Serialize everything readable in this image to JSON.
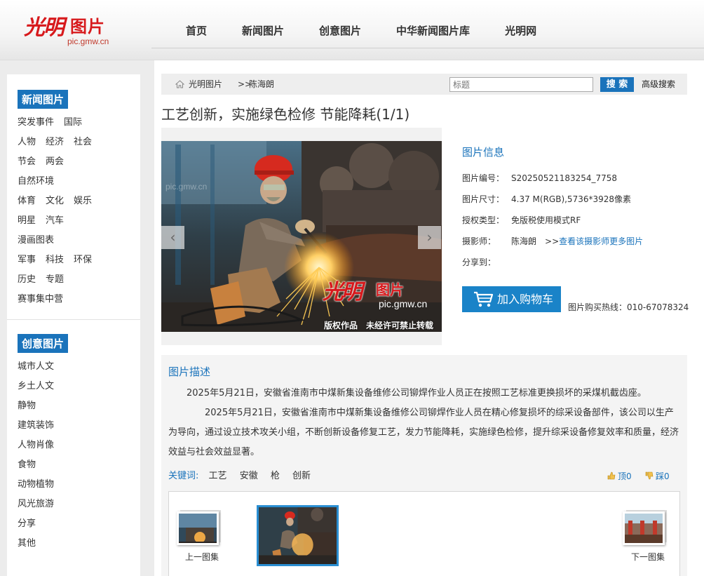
{
  "header": {
    "logo_mark": "光明",
    "logo_word": "图片",
    "logo_url": "pic.gmw.cn",
    "nav": [
      "首页",
      "新闻图片",
      "创意图片",
      "中华新闻图片库",
      "光明网"
    ]
  },
  "sidebar": {
    "news": {
      "title": "新闻图片",
      "rows": [
        [
          "突发事件",
          "国际"
        ],
        [
          "人物",
          "经济",
          "社会"
        ],
        [
          "节会",
          "两会"
        ],
        [
          "自然环境"
        ],
        [
          "体育",
          "文化",
          "娱乐"
        ],
        [
          "明星",
          "汽车"
        ],
        [
          "漫画图表"
        ],
        [
          "军事",
          "科技",
          "环保"
        ],
        [
          "历史",
          "专题"
        ],
        [
          "赛事集中营"
        ]
      ]
    },
    "creative": {
      "title": "创意图片",
      "rows": [
        [
          "城市人文"
        ],
        [
          "乡土人文"
        ],
        [
          "静物"
        ],
        [
          "建筑装饰"
        ],
        [
          "人物肖像"
        ],
        [
          "食物"
        ],
        [
          "动物植物"
        ],
        [
          "风光旅游"
        ],
        [
          "分享"
        ],
        [
          "其他"
        ]
      ]
    }
  },
  "breadcrumb": {
    "home": "光明图片",
    "separator": ">>",
    "current": "陈海朗"
  },
  "search": {
    "placeholder": "标题",
    "button": "搜 索",
    "advanced": "高级搜索"
  },
  "title": "工艺创新，实施绿色检修 节能降耗(1/1)",
  "photo": {
    "watermark_mark": "光明",
    "watermark_word": "图片",
    "watermark_url": "pic.gmw.cn",
    "copyright": "版权作品　未经许可禁止转载",
    "ghost": "pic.gmw.cn",
    "prev_arrow": "‹",
    "next_arrow": "›"
  },
  "info": {
    "title": "图片信息",
    "id_key": "图片编号：",
    "id_val": "S20250521183254_7758",
    "size_key": "图片尺寸：",
    "size_val": "4.37 M(RGB),5736*3928像素",
    "license_key": "授权类型：",
    "license_val": "免版税使用模式RF",
    "photographer_key": "摄影师：",
    "photographer_val": "陈海朗",
    "photographer_link_prefix": ">>",
    "photographer_link": "查看该摄影师更多图片",
    "share_key": "分享到："
  },
  "cart": {
    "button": "加入购物车",
    "hotline": "图片购买热线：010-67078324"
  },
  "description": {
    "title": "图片描述",
    "p1": "2025年5月21日，安徽省淮南市中煤新集设备维修公司铆焊作业人员正在按照工艺标准更换损坏的采煤机截齿座。",
    "p2": "2025年5月21日，安徽省淮南市中煤新集设备维修公司铆焊作业人员在精心修复损坏的综采设备部件，该公司以生产为导向，通过设立技术攻关小组，不断创新设备修复工艺，发力节能降耗，实施绿色检修，提升综采设备修复效率和质量，经济效益与社会效益显著。"
  },
  "keywords": {
    "label": "关键词:",
    "items": [
      "工艺",
      "安徽",
      "枪",
      "创新"
    ]
  },
  "votes": {
    "up": "顶0",
    "down": "踩0"
  },
  "thumbs": {
    "prev_label": "上一图集",
    "next_label": "下一图集"
  },
  "colors": {
    "accent": "#1a73bb",
    "logo_red": "#d7191c",
    "helmet": "#d62a1f"
  }
}
